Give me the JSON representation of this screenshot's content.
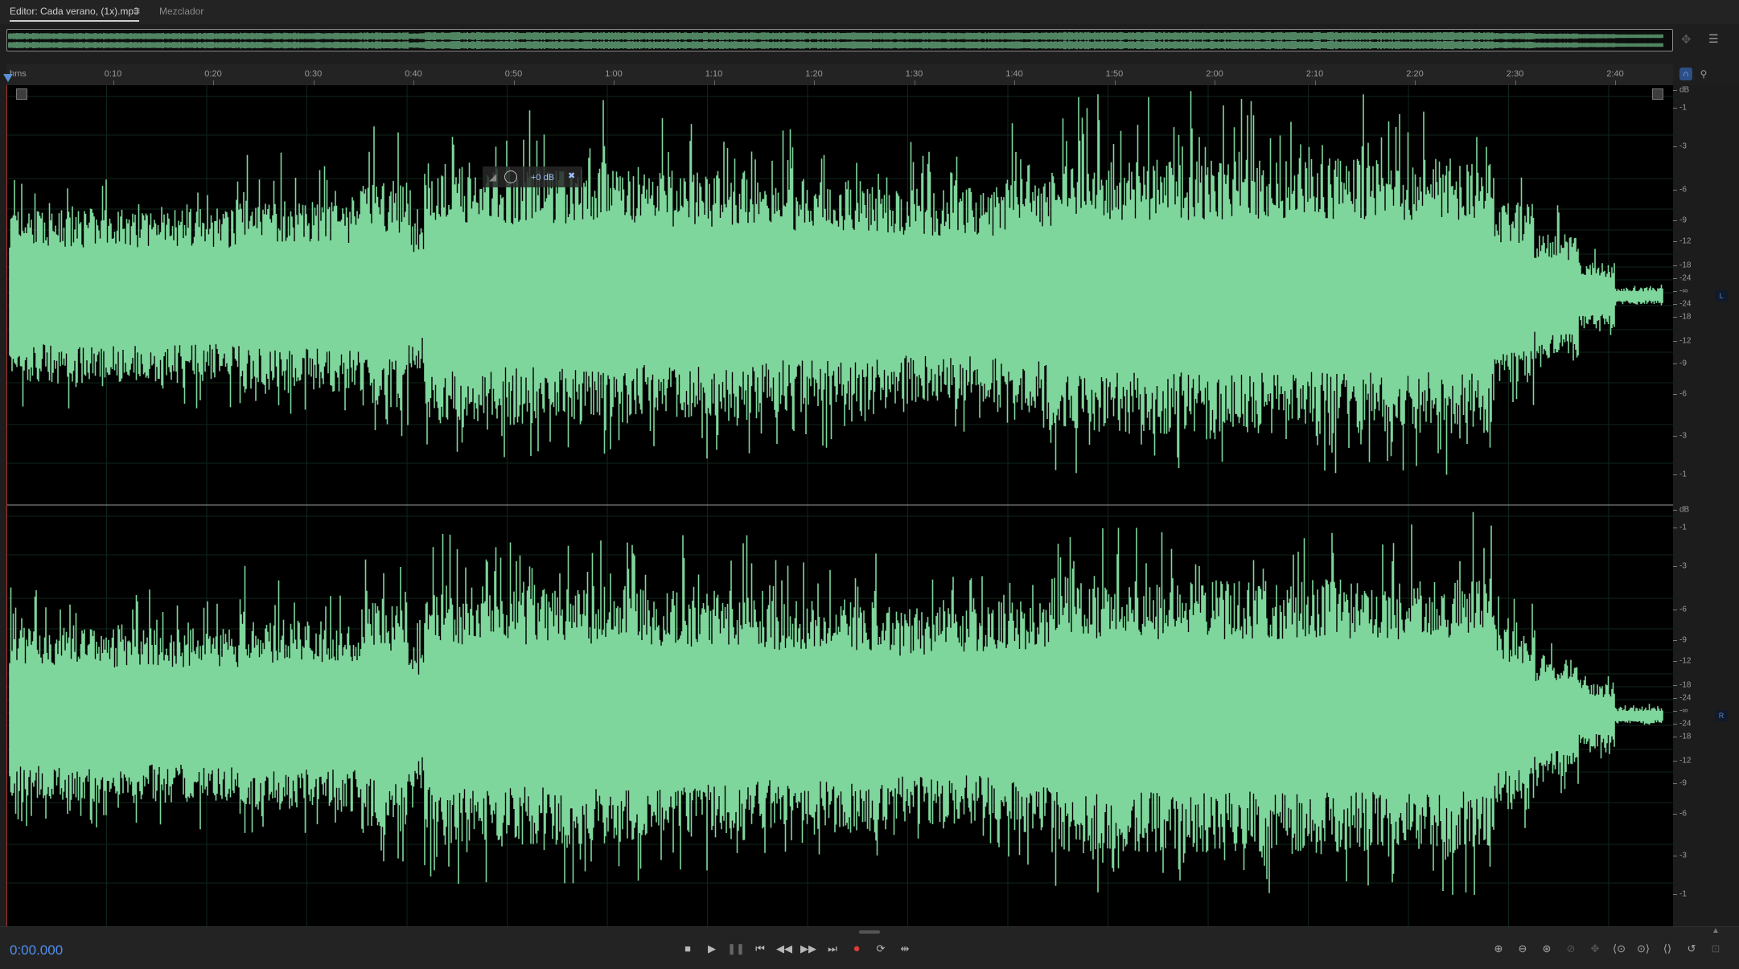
{
  "tabs": {
    "editor_label": "Editor: Cada verano, (1x).mp3",
    "editor_menu_icon": "≡",
    "mixer_label": "Mezclador"
  },
  "ruler": {
    "unit": "hms",
    "labels": [
      "0:10",
      "0:20",
      "0:30",
      "0:40",
      "0:50",
      "1:00",
      "1:10",
      "1:20",
      "1:30",
      "1:40",
      "1:50",
      "2:00",
      "2:10",
      "2:20",
      "2:30",
      "2:40"
    ]
  },
  "db_scale": {
    "unit": "dB",
    "labels": [
      "-1",
      "-3",
      "-6",
      "-9",
      "-12",
      "-18",
      "-24",
      "-∞",
      "-24",
      "-18",
      "-12",
      "-9",
      "-6",
      "-3",
      "-1"
    ]
  },
  "channels": {
    "left": "L",
    "right": "R"
  },
  "hud": {
    "volume": "+0 dB"
  },
  "transport": {
    "time": "0:00.000"
  },
  "colors": {
    "waveform": "#7fd69c",
    "background": "#000000",
    "accent": "#4f8ff0",
    "record": "#e03a3a"
  }
}
